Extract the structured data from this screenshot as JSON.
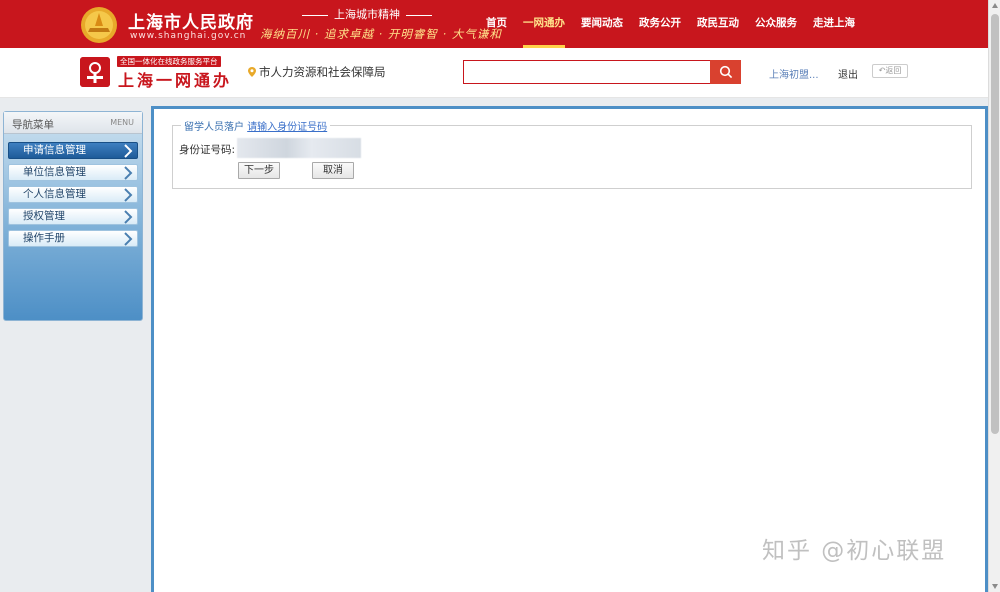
{
  "gov_header": {
    "title": "上海市人民政府",
    "url": "www.shanghai.gov.cn",
    "spirit_title": "上海城市精神",
    "spirit_slogan": "海纳百川 · 追求卓越 · 开明睿智 · 大气谦和",
    "nav": [
      {
        "label": "首页",
        "active": false
      },
      {
        "label": "一网通办",
        "active": true
      },
      {
        "label": "要闻动态",
        "active": false
      },
      {
        "label": "政务公开",
        "active": false
      },
      {
        "label": "政民互动",
        "active": false
      },
      {
        "label": "公众服务",
        "active": false
      },
      {
        "label": "走进上海",
        "active": false
      }
    ],
    "colors": {
      "brand_red": "#c8161d",
      "nav_active": "#ffe08a"
    }
  },
  "sub_header": {
    "platform_tag": "全国一体化在线政务服务平台",
    "platform_name": "上海一网通办",
    "department": "市人力资源和社会保障局",
    "search_value": "",
    "search_icon": "search-icon",
    "user_link": "上海初盟...",
    "logout": "退出",
    "back": "返回"
  },
  "leftnav": {
    "title": "导航菜单",
    "menu_tag": "MENU",
    "items": [
      {
        "label": "申请信息管理",
        "active": true
      },
      {
        "label": "单位信息管理",
        "active": false
      },
      {
        "label": "个人信息管理",
        "active": false
      },
      {
        "label": "授权管理",
        "active": false
      },
      {
        "label": "操作手册",
        "active": false
      }
    ],
    "colors": {
      "active_bg": "#1e5b99",
      "panel_bg": "#4d8fc6"
    }
  },
  "main": {
    "legend_part1": "留学人员落户",
    "legend_part2": "请输入身份证号码",
    "id_label": "身份证号码:",
    "id_value": "",
    "next_button": "下一步",
    "cancel_button": "取消"
  },
  "watermark": "知乎 @初心联盟"
}
